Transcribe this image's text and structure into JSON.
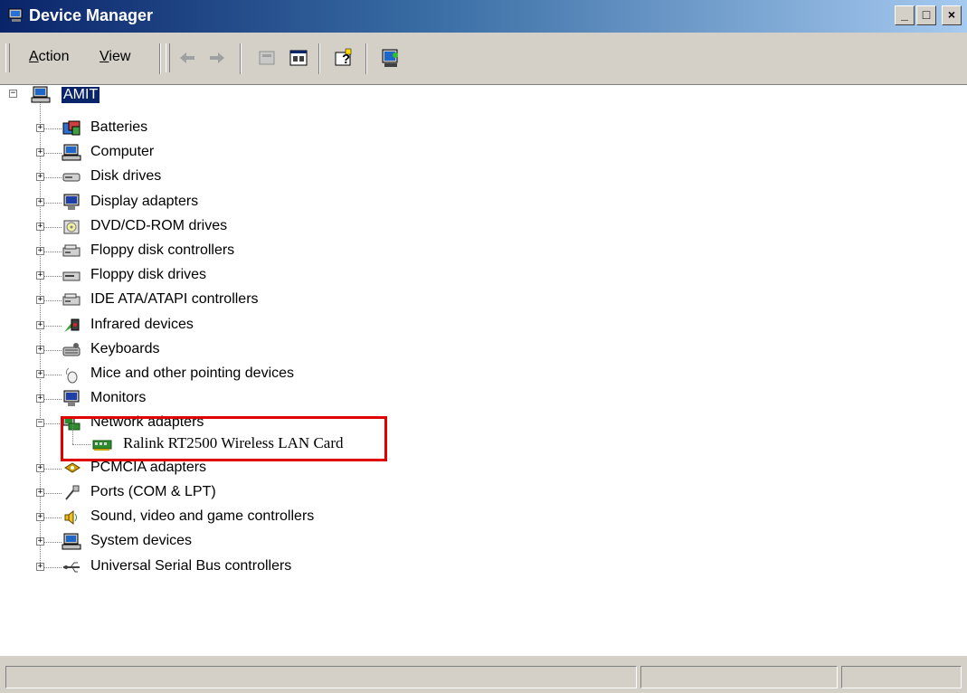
{
  "window": {
    "title": "Device Manager",
    "controls": {
      "minimize": "_",
      "maximize": "□",
      "close": "×"
    }
  },
  "toolbar": {
    "menus": [
      {
        "label": "Action",
        "accel": "A",
        "rest": "ction"
      },
      {
        "label": "View",
        "accel": "V",
        "rest": "iew"
      }
    ],
    "buttons": [
      "back-icon",
      "forward-icon",
      "up-icon",
      "properties-icon",
      "help-icon",
      "scan-hardware-icon"
    ]
  },
  "tree": {
    "root": {
      "label": "AMIT",
      "icon": "computer-icon"
    },
    "items": [
      {
        "label": "Batteries",
        "icon": "battery-icon",
        "expanded": false
      },
      {
        "label": "Computer",
        "icon": "computer-icon",
        "expanded": false
      },
      {
        "label": "Disk drives",
        "icon": "disk-drive-icon",
        "expanded": false
      },
      {
        "label": "Display adapters",
        "icon": "display-adapter-icon",
        "expanded": false
      },
      {
        "label": "DVD/CD-ROM drives",
        "icon": "cdrom-icon",
        "expanded": false
      },
      {
        "label": "Floppy disk controllers",
        "icon": "controller-icon",
        "expanded": false
      },
      {
        "label": "Floppy disk drives",
        "icon": "floppy-icon",
        "expanded": false
      },
      {
        "label": "IDE ATA/ATAPI controllers",
        "icon": "controller-icon",
        "expanded": false
      },
      {
        "label": "Infrared devices",
        "icon": "infrared-icon",
        "expanded": false
      },
      {
        "label": "Keyboards",
        "icon": "keyboard-icon",
        "expanded": false
      },
      {
        "label": "Mice and other pointing devices",
        "icon": "mouse-icon",
        "expanded": false
      },
      {
        "label": "Monitors",
        "icon": "monitor-icon",
        "expanded": false
      },
      {
        "label": "Network adapters",
        "icon": "network-adapter-icon",
        "expanded": true,
        "children": [
          {
            "label": "Ralink RT2500 Wireless LAN Card",
            "icon": "network-card-icon"
          }
        ]
      },
      {
        "label": "PCMCIA adapters",
        "icon": "pcmcia-icon",
        "expanded": false
      },
      {
        "label": "Ports (COM & LPT)",
        "icon": "port-icon",
        "expanded": false
      },
      {
        "label": "Sound, video and game controllers",
        "icon": "speaker-icon",
        "expanded": false
      },
      {
        "label": "System devices",
        "icon": "system-icon",
        "expanded": false
      },
      {
        "label": "Universal Serial Bus controllers",
        "icon": "usb-icon",
        "expanded": false
      }
    ]
  },
  "statusbar": {
    "panels": [
      "",
      "",
      ""
    ]
  },
  "colors": {
    "selection": "#0a246a",
    "highlight_box": "#e00000",
    "chrome": "#d4d0c8"
  }
}
